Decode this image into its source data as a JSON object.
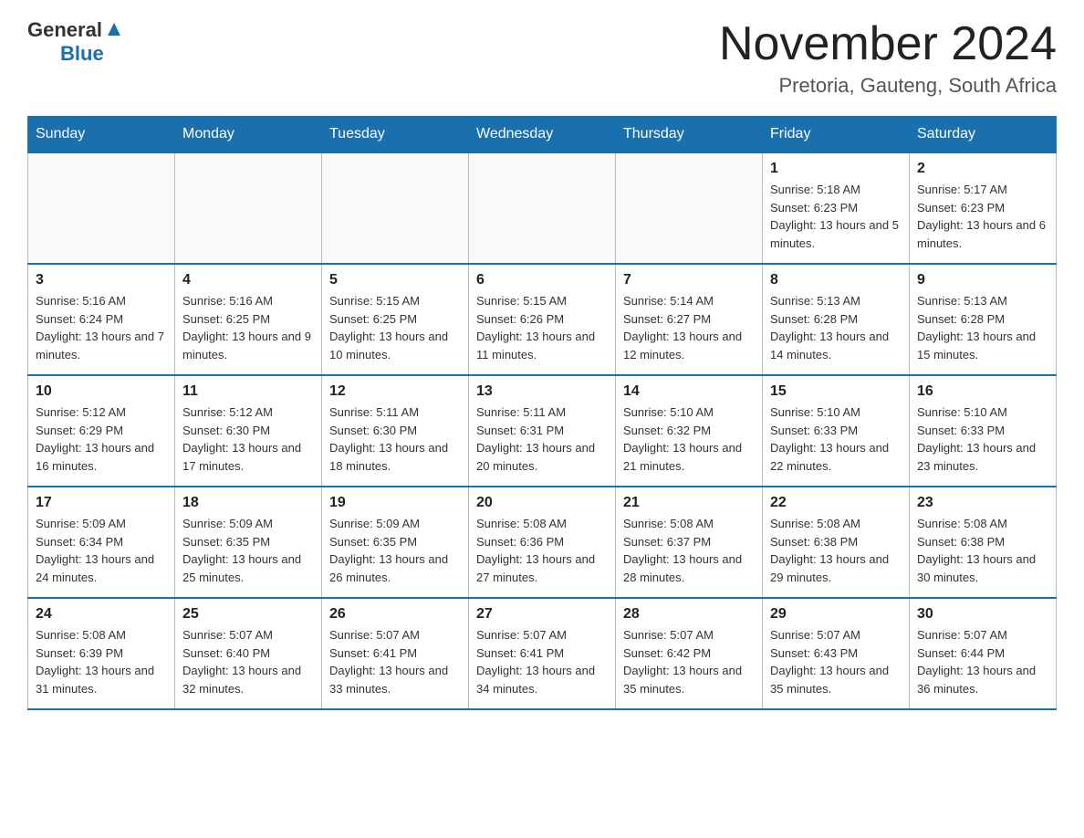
{
  "logo": {
    "general": "General",
    "blue": "Blue"
  },
  "header": {
    "month": "November 2024",
    "location": "Pretoria, Gauteng, South Africa"
  },
  "weekdays": [
    "Sunday",
    "Monday",
    "Tuesday",
    "Wednesday",
    "Thursday",
    "Friday",
    "Saturday"
  ],
  "weeks": [
    [
      {
        "day": "",
        "info": ""
      },
      {
        "day": "",
        "info": ""
      },
      {
        "day": "",
        "info": ""
      },
      {
        "day": "",
        "info": ""
      },
      {
        "day": "",
        "info": ""
      },
      {
        "day": "1",
        "info": "Sunrise: 5:18 AM\nSunset: 6:23 PM\nDaylight: 13 hours and 5 minutes."
      },
      {
        "day": "2",
        "info": "Sunrise: 5:17 AM\nSunset: 6:23 PM\nDaylight: 13 hours and 6 minutes."
      }
    ],
    [
      {
        "day": "3",
        "info": "Sunrise: 5:16 AM\nSunset: 6:24 PM\nDaylight: 13 hours and 7 minutes."
      },
      {
        "day": "4",
        "info": "Sunrise: 5:16 AM\nSunset: 6:25 PM\nDaylight: 13 hours and 9 minutes."
      },
      {
        "day": "5",
        "info": "Sunrise: 5:15 AM\nSunset: 6:25 PM\nDaylight: 13 hours and 10 minutes."
      },
      {
        "day": "6",
        "info": "Sunrise: 5:15 AM\nSunset: 6:26 PM\nDaylight: 13 hours and 11 minutes."
      },
      {
        "day": "7",
        "info": "Sunrise: 5:14 AM\nSunset: 6:27 PM\nDaylight: 13 hours and 12 minutes."
      },
      {
        "day": "8",
        "info": "Sunrise: 5:13 AM\nSunset: 6:28 PM\nDaylight: 13 hours and 14 minutes."
      },
      {
        "day": "9",
        "info": "Sunrise: 5:13 AM\nSunset: 6:28 PM\nDaylight: 13 hours and 15 minutes."
      }
    ],
    [
      {
        "day": "10",
        "info": "Sunrise: 5:12 AM\nSunset: 6:29 PM\nDaylight: 13 hours and 16 minutes."
      },
      {
        "day": "11",
        "info": "Sunrise: 5:12 AM\nSunset: 6:30 PM\nDaylight: 13 hours and 17 minutes."
      },
      {
        "day": "12",
        "info": "Sunrise: 5:11 AM\nSunset: 6:30 PM\nDaylight: 13 hours and 18 minutes."
      },
      {
        "day": "13",
        "info": "Sunrise: 5:11 AM\nSunset: 6:31 PM\nDaylight: 13 hours and 20 minutes."
      },
      {
        "day": "14",
        "info": "Sunrise: 5:10 AM\nSunset: 6:32 PM\nDaylight: 13 hours and 21 minutes."
      },
      {
        "day": "15",
        "info": "Sunrise: 5:10 AM\nSunset: 6:33 PM\nDaylight: 13 hours and 22 minutes."
      },
      {
        "day": "16",
        "info": "Sunrise: 5:10 AM\nSunset: 6:33 PM\nDaylight: 13 hours and 23 minutes."
      }
    ],
    [
      {
        "day": "17",
        "info": "Sunrise: 5:09 AM\nSunset: 6:34 PM\nDaylight: 13 hours and 24 minutes."
      },
      {
        "day": "18",
        "info": "Sunrise: 5:09 AM\nSunset: 6:35 PM\nDaylight: 13 hours and 25 minutes."
      },
      {
        "day": "19",
        "info": "Sunrise: 5:09 AM\nSunset: 6:35 PM\nDaylight: 13 hours and 26 minutes."
      },
      {
        "day": "20",
        "info": "Sunrise: 5:08 AM\nSunset: 6:36 PM\nDaylight: 13 hours and 27 minutes."
      },
      {
        "day": "21",
        "info": "Sunrise: 5:08 AM\nSunset: 6:37 PM\nDaylight: 13 hours and 28 minutes."
      },
      {
        "day": "22",
        "info": "Sunrise: 5:08 AM\nSunset: 6:38 PM\nDaylight: 13 hours and 29 minutes."
      },
      {
        "day": "23",
        "info": "Sunrise: 5:08 AM\nSunset: 6:38 PM\nDaylight: 13 hours and 30 minutes."
      }
    ],
    [
      {
        "day": "24",
        "info": "Sunrise: 5:08 AM\nSunset: 6:39 PM\nDaylight: 13 hours and 31 minutes."
      },
      {
        "day": "25",
        "info": "Sunrise: 5:07 AM\nSunset: 6:40 PM\nDaylight: 13 hours and 32 minutes."
      },
      {
        "day": "26",
        "info": "Sunrise: 5:07 AM\nSunset: 6:41 PM\nDaylight: 13 hours and 33 minutes."
      },
      {
        "day": "27",
        "info": "Sunrise: 5:07 AM\nSunset: 6:41 PM\nDaylight: 13 hours and 34 minutes."
      },
      {
        "day": "28",
        "info": "Sunrise: 5:07 AM\nSunset: 6:42 PM\nDaylight: 13 hours and 35 minutes."
      },
      {
        "day": "29",
        "info": "Sunrise: 5:07 AM\nSunset: 6:43 PM\nDaylight: 13 hours and 35 minutes."
      },
      {
        "day": "30",
        "info": "Sunrise: 5:07 AM\nSunset: 6:44 PM\nDaylight: 13 hours and 36 minutes."
      }
    ]
  ]
}
